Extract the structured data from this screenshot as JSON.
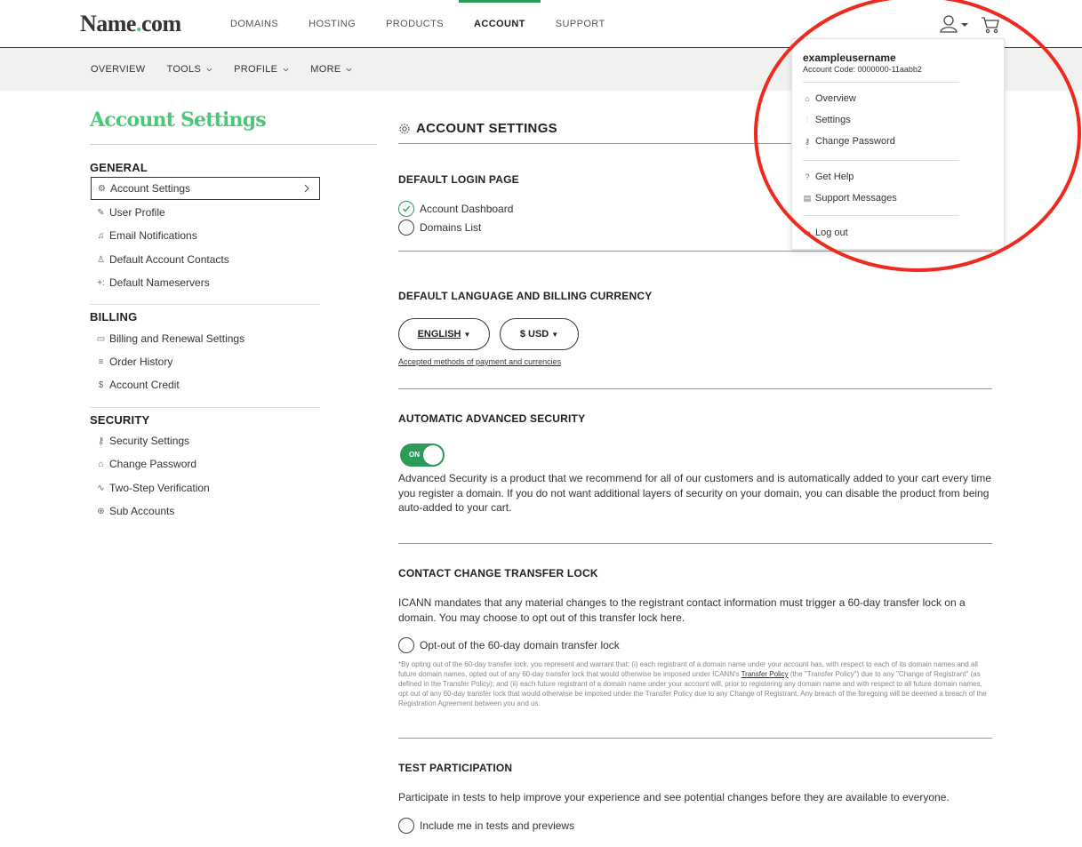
{
  "brand": {
    "logo_prefix": "Name",
    "logo_dot": ".",
    "logo_suffix": "com",
    "accent_color": "#4cc77a",
    "primary_green": "#2e9a57"
  },
  "top_nav": {
    "items": [
      {
        "label": "DOMAINS"
      },
      {
        "label": "HOSTING"
      },
      {
        "label": "PRODUCTS"
      },
      {
        "label": "ACCOUNT",
        "active": true
      },
      {
        "label": "SUPPORT"
      }
    ],
    "icons": [
      "user-icon",
      "caret-down-icon",
      "cart-icon"
    ]
  },
  "sub_nav": {
    "items": [
      {
        "label": "OVERVIEW"
      },
      {
        "label": "TOOLS",
        "dropdown": true
      },
      {
        "label": "PROFILE",
        "dropdown": true
      },
      {
        "label": "MORE",
        "dropdown": true
      }
    ]
  },
  "sidebar": {
    "title": "Account Settings",
    "sections": [
      {
        "heading": "GENERAL",
        "items": [
          {
            "label": "Account Settings",
            "icon": "gear-icon",
            "selected": true
          },
          {
            "label": "User Profile",
            "icon": "edit-icon"
          },
          {
            "label": "Email Notifications",
            "icon": "bell-icon"
          },
          {
            "label": "Default Account Contacts",
            "icon": "person-icon"
          },
          {
            "label": "Default Nameservers",
            "icon": "nameserver-icon"
          }
        ]
      },
      {
        "heading": "BILLING",
        "items": [
          {
            "label": "Billing and Renewal Settings",
            "icon": "card-icon"
          },
          {
            "label": "Order History",
            "icon": "list-icon"
          },
          {
            "label": "Account Credit",
            "icon": "dollar-icon"
          }
        ]
      },
      {
        "heading": "SECURITY",
        "items": [
          {
            "label": "Security Settings",
            "icon": "key-icon"
          },
          {
            "label": "Change Password",
            "icon": "lock-icon"
          },
          {
            "label": "Two-Step Verification",
            "icon": "two-step-icon"
          },
          {
            "label": "Sub Accounts",
            "icon": "plus-circle-icon"
          }
        ]
      }
    ]
  },
  "main": {
    "heading": "ACCOUNT SETTINGS",
    "login_page": {
      "title": "DEFAULT LOGIN PAGE",
      "options": [
        {
          "label": "Account Dashboard",
          "checked": true
        },
        {
          "label": "Domains List",
          "checked": false
        }
      ]
    },
    "language": {
      "title": "DEFAULT LANGUAGE AND BILLING CURRENCY",
      "language_value": "ENGLISH",
      "currency_value": "$ USD",
      "link": "Accepted methods of payment and currencies"
    },
    "security": {
      "title": "AUTOMATIC ADVANCED SECURITY",
      "toggle_label": "ON",
      "toggle_on": true,
      "description": "Advanced Security is a product that we recommend for all of our customers and is automatically added to your cart every time you register a domain. If you do not want additional layers of security on your domain, you can disable the product from being auto-added to your cart."
    },
    "transfer_lock": {
      "title": "CONTACT CHANGE TRANSFER LOCK",
      "description": "ICANN mandates that any material changes to the registrant contact information must trigger a 60-day transfer lock on a domain. You may choose to opt out of this transfer lock here.",
      "option": "Opt-out of the 60-day domain transfer lock",
      "fine_print_before": "*By opting out of the 60-day transfer lock, you represent and warrant that: (i) each registrant of a domain name under your account has, with respect to each of its domain names and all future domain names, opted out of any 60-day transfer lock that would otherwise be imposed under ICANN's ",
      "fine_print_link": "Transfer Policy",
      "fine_print_after": " (the \"Transfer Policy\") due to any \"Change of Registrant\" (as defined in the Transfer Policy); and (ii) each future registrant of a domain name under your account will, prior to registering any domain name and with respect to all future domain names, opt out of any 60-day transfer lock that would otherwise be imposed under the Transfer Policy due to any Change of Registrant. Any breach of the foregoing will be deemed a breach of the Registration Agreement between you and us."
    },
    "tests": {
      "title": "TEST PARTICIPATION",
      "description": "Participate in tests to help improve your experience and see potential changes before they are available to everyone.",
      "option": "Include me in tests and previews"
    }
  },
  "user_menu": {
    "username": "exampleusername",
    "account_code": "Account Code: 0000000-11aabb2",
    "items": [
      {
        "label": "Overview",
        "icon": "home-icon"
      },
      {
        "label": "Settings",
        "icon": "sliders-icon"
      },
      {
        "label": "Change Password",
        "icon": "key-icon"
      },
      {
        "label": "Get Help",
        "icon": "help-icon"
      },
      {
        "label": "Support Messages",
        "icon": "inbox-icon"
      },
      {
        "label": "Log out",
        "icon": "logout-icon"
      }
    ],
    "highlight_color": "#ee2a1e"
  }
}
